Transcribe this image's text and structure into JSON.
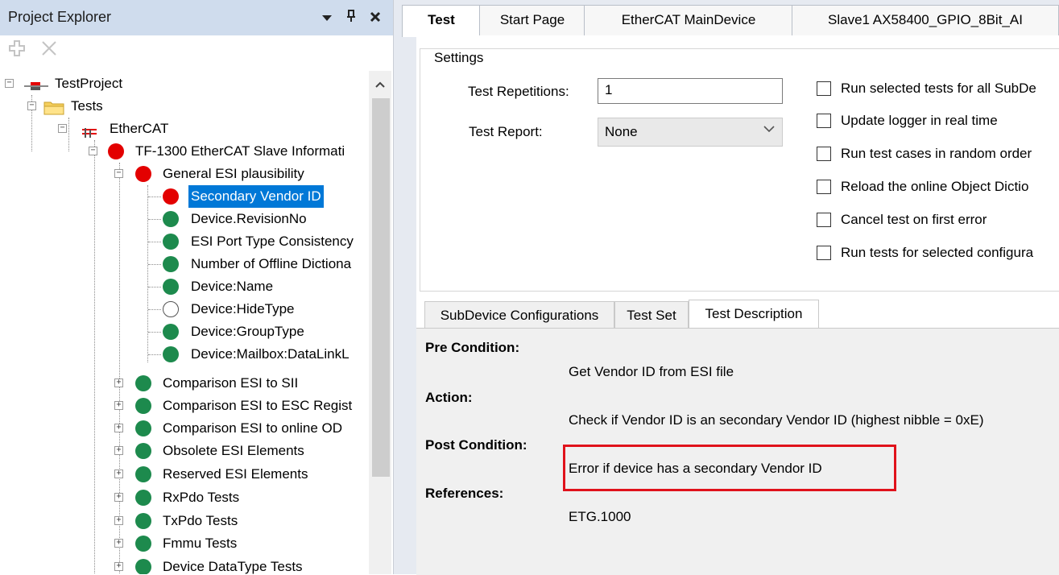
{
  "project_explorer": {
    "title": "Project Explorer",
    "header_buttons": [
      "dropdown-icon",
      "pin-icon",
      "close-icon"
    ],
    "pin_glyph": "ᵖ",
    "toolbar_icons": [
      "add-icon",
      "delete-icon"
    ],
    "tree": [
      {
        "label": "TestProject",
        "status": "project"
      },
      {
        "label": "Tests",
        "status": "folder"
      },
      {
        "label": "EtherCAT",
        "status": "ethercat"
      },
      {
        "label": "TF-1300 EtherCAT Slave Informati",
        "status": "red"
      },
      {
        "label": "General ESI plausibility",
        "status": "red"
      },
      {
        "label": "Secondary Vendor ID",
        "status": "red"
      },
      {
        "label": "Device.RevisionNo",
        "status": "green"
      },
      {
        "label": "ESI Port Type Consistency",
        "status": "green"
      },
      {
        "label": "Number of Offline Dictiona",
        "status": "green"
      },
      {
        "label": "Device:Name",
        "status": "green"
      },
      {
        "label": "Device:HideType",
        "status": "empty"
      },
      {
        "label": "Device:GroupType",
        "status": "green"
      },
      {
        "label": "Device:Mailbox:DataLinkL",
        "status": "green"
      },
      {
        "label": "Comparison ESI to SII",
        "status": "green"
      },
      {
        "label": "Comparison ESI to ESC Regist",
        "status": "green"
      },
      {
        "label": "Comparison ESI to online OD",
        "status": "green"
      },
      {
        "label": "Obsolete ESI Elements",
        "status": "green"
      },
      {
        "label": "Reserved ESI Elements",
        "status": "green"
      },
      {
        "label": "RxPdo Tests",
        "status": "green"
      },
      {
        "label": "TxPdo Tests",
        "status": "green"
      },
      {
        "label": "Fmmu Tests",
        "status": "green"
      },
      {
        "label": "Device DataType Tests",
        "status": "green"
      }
    ]
  },
  "document_tabs": [
    "Test",
    "Start Page",
    "EtherCAT MainDevice",
    "Slave1 AX58400_GPIO_8Bit_AI"
  ],
  "settings": {
    "legend": "Settings",
    "repetitions_label": "Test Repetitions:",
    "repetitions_value": "1",
    "report_label": "Test Report:",
    "report_value": "None",
    "checkboxes": [
      "Run selected tests for all SubDe",
      "Update logger in real time",
      "Run test cases in random order",
      "Reload the online Object Dictio",
      "Cancel test on first error",
      "Run tests for selected configura"
    ]
  },
  "lower_tabs": [
    "SubDevice Configurations",
    "Test Set",
    "Test Description"
  ],
  "description": {
    "pre_condition_label": "Pre Condition:",
    "pre_condition": "Get Vendor ID from ESI file",
    "action_label": "Action:",
    "action": "Check if Vendor ID is an secondary Vendor ID (highest nibble = 0xE)",
    "post_condition_label": "Post Condition:",
    "post_condition": "Error if device has a secondary Vendor ID",
    "references_label": "References:",
    "references": "ETG.1000"
  },
  "colors": {
    "status_red": "#e30000",
    "status_green": "#1d8a4d",
    "selection": "#0078d7",
    "highlight_box": "#e0121b",
    "header_bg": "#cfdced"
  }
}
